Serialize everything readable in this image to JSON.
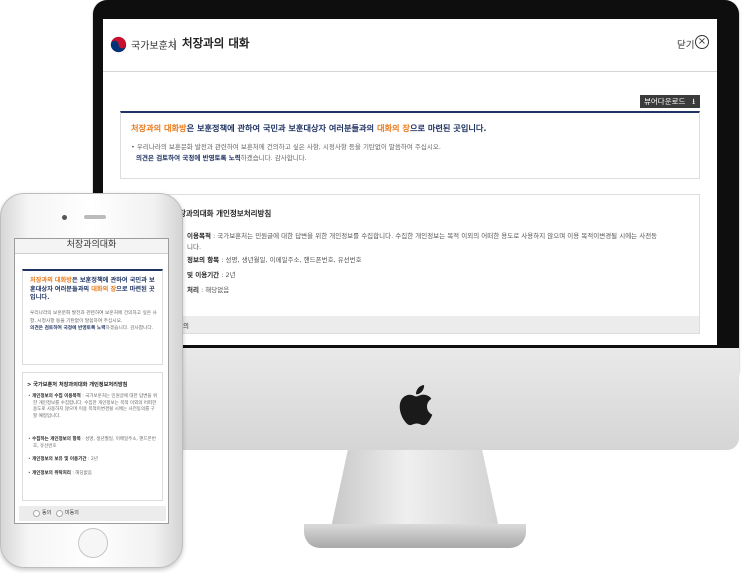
{
  "desktop": {
    "header": {
      "org_name": "국가보훈처",
      "page_title": "처장과의 대화",
      "close_label": "닫기"
    },
    "viewer_download_label": "뷰어다운로드",
    "intro": {
      "title_part1": "처장과의 대화방",
      "title_part2": "은 보훈정책에 관하여 국민과 보훈대상자 여러분들과의 ",
      "title_part3": "대화의 장",
      "title_part4": "으로 마련된 곳입니다.",
      "desc_line1": "• 우리나라의 보훈문화 발전과 관련하여 보훈처에 건의하고 싶은 사항, 시정사항 등을 기탄없이 말씀하여 주십시오.",
      "desc_line2_bold": "의견은 검토하여 국정에 반영토록 노력",
      "desc_line2_rest": "하겠습니다. 감사합니다."
    },
    "privacy": {
      "title": "장과의대화 개인정보처리방침",
      "line1_bold": "이용목적",
      "line1_rest": " : 국가보훈처는 민원글에 대한 답변을 위한 개인정보를 수집합니다. 수집한 개인정보는 목적 이외의 어떠한 용도로 사용하지 않으며 이용 목적이변경될 시에는 사전동",
      "line2": "니다.",
      "line3_bold": "정보의 항목",
      "line3_rest": " : 성명, 생년월일, 이메일주소, 핸드폰번호, 유선번호",
      "line4_bold": "및 이용기간",
      "line4_rest": " : 2년",
      "line5_bold": "처리",
      "line5_rest": " : 해당없음",
      "consent_partial": "의"
    }
  },
  "mobile": {
    "header_title": "처장과의대화",
    "intro": {
      "title_part1": "처장과의 대화방",
      "title_part2": "은 보훈정책에 관하여 국민과 보훈대상자 여러분들과의 ",
      "title_part3": "대화의 장",
      "title_part4": "으로 마련된 곳입니다.",
      "desc": "우리나라의 보훈문화 발전과 관련하여 보훈처에 건의하고 싶은 사항, 시정사항 등을 기탄없이 말씀하여 주십시오.",
      "desc_bold": "의견은 검토하여 국정에 반영토록 노력",
      "desc_rest": "하겠습니다. 감사합니다."
    },
    "privacy": {
      "title": "> 국가보훈처 처장과의대화 개인정보처리방침",
      "item1_label": "개인정보의 수집 이용목적",
      "item1_text": " : 국가보훈처는 민원글에 대한 답변을 위한 개인정보를 수집합니다. 수집한 개인정보는 목적 이외의 어떠한 용도로 사용하지 않으며 이용 목적이변경될 시에는 사전동의를 구할 예정입니다.",
      "item2_label": "수집하는 개인정보의 항목",
      "item2_text": " : 성명, 생년월일, 이메일주소, 핸드폰번호, 유선번호",
      "item3_label": "개인정보의 보유 및 이용기간",
      "item3_text": " : 2년",
      "item4_label": "개인정보의 위탁처리",
      "item4_text": " : 해당없음"
    },
    "consent": {
      "agree": "동의",
      "disagree": "미동의"
    }
  },
  "colors": {
    "navy": "#203463",
    "orange": "#e87a1b",
    "button_dark": "#3b3b3b"
  }
}
